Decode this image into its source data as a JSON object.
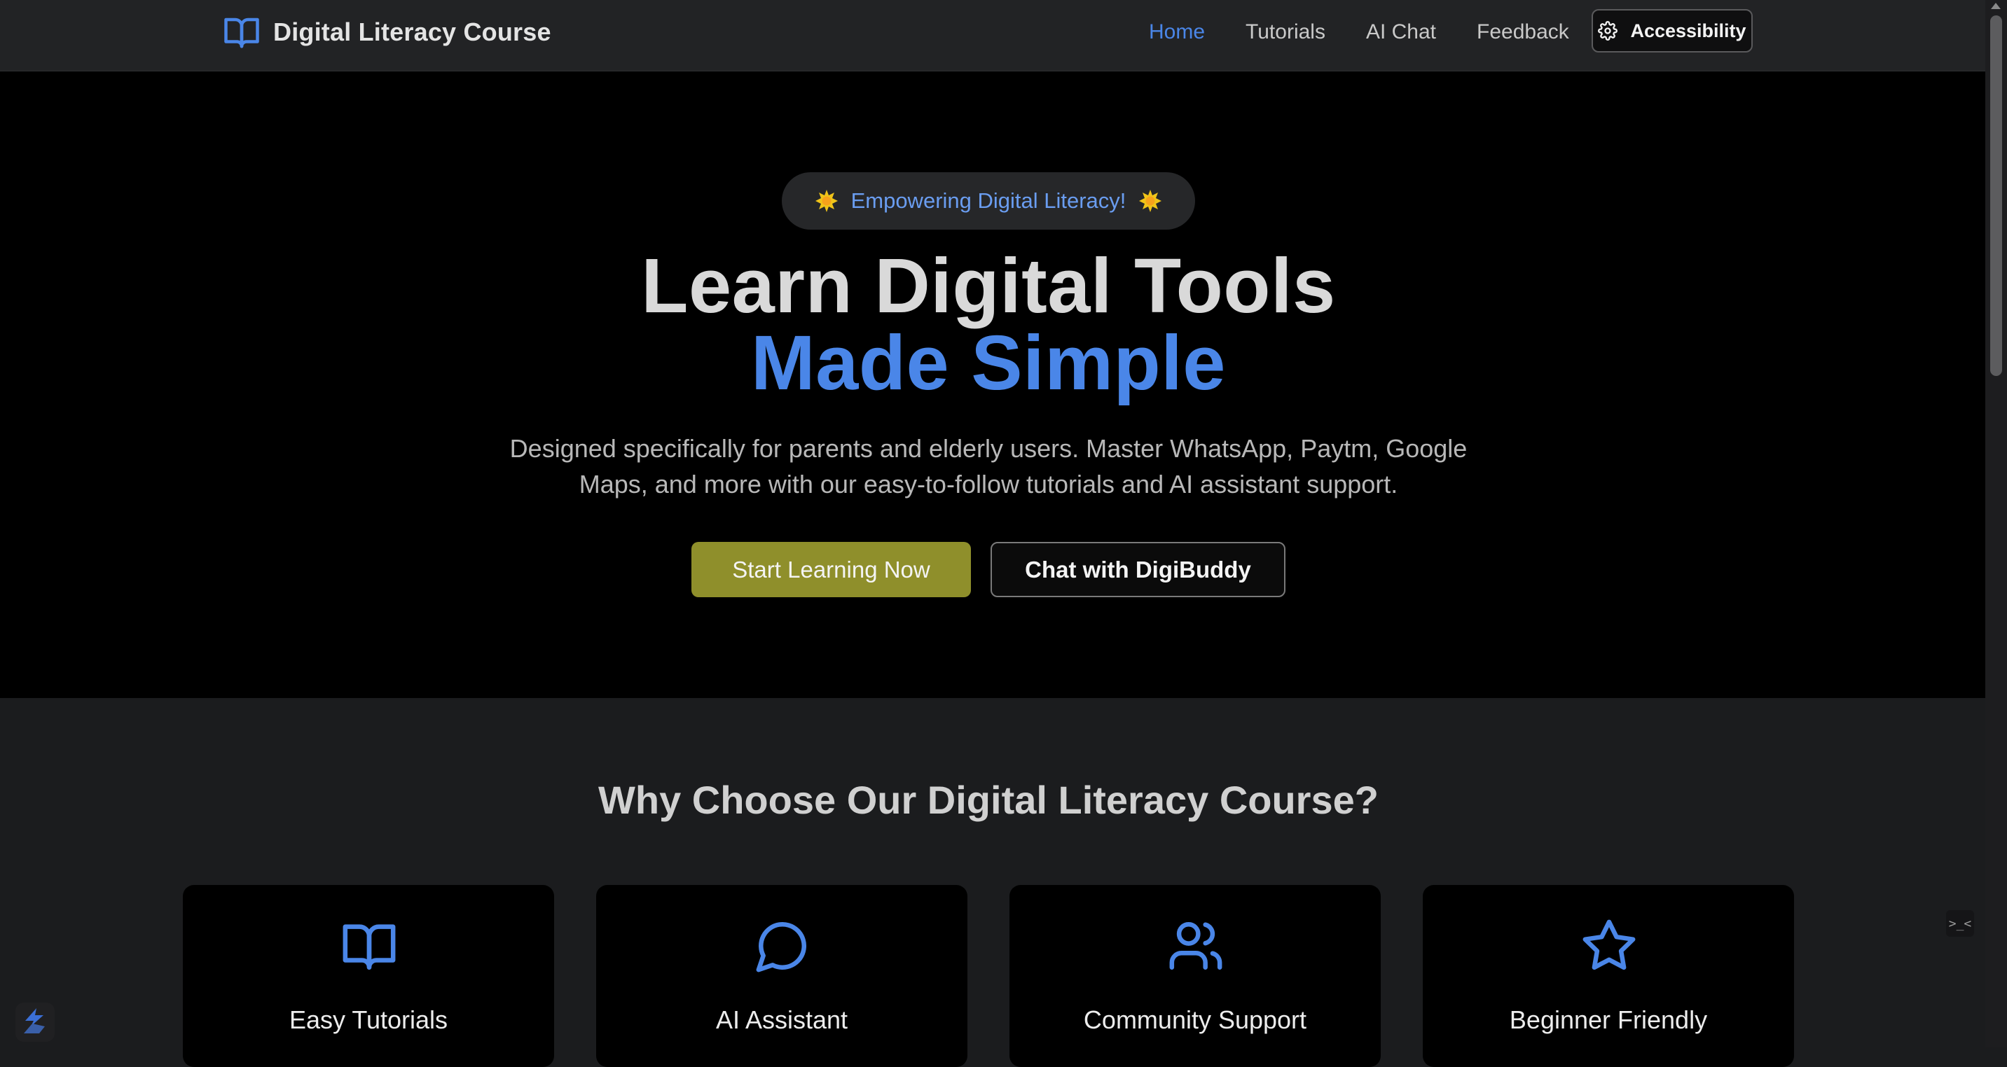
{
  "nav": {
    "brand_title": "Digital Literacy Course",
    "links": [
      {
        "label": "Home",
        "active": true
      },
      {
        "label": "Tutorials",
        "active": false
      },
      {
        "label": "AI Chat",
        "active": false
      },
      {
        "label": "Feedback",
        "active": false
      }
    ],
    "accessibility_label": "Accessibility"
  },
  "hero": {
    "badge": "Empowering Digital Literacy!",
    "headline_line1": "Learn Digital Tools",
    "headline_line2": "Made Simple",
    "description": "Designed specifically for parents and elderly users. Master WhatsApp, Paytm, Google Maps, and more with our easy-to-follow tutorials and AI assistant support.",
    "primary_cta": "Start Learning Now",
    "secondary_cta": "Chat with DigiBuddy"
  },
  "features": {
    "title": "Why Choose Our Digital Literacy Course?",
    "cards": [
      {
        "title": "Easy Tutorials",
        "icon": "book-open-icon"
      },
      {
        "title": "AI Assistant",
        "icon": "message-circle-icon"
      },
      {
        "title": "Community Support",
        "icon": "users-icon"
      },
      {
        "title": "Beginner Friendly",
        "icon": "star-icon"
      }
    ]
  },
  "colors": {
    "accent": "#4a86e8",
    "primary_button": "#8f8f2b",
    "hero_background": "#000000",
    "page_background": "#1b1c1e"
  },
  "dev_tab_glyph": ">_<"
}
